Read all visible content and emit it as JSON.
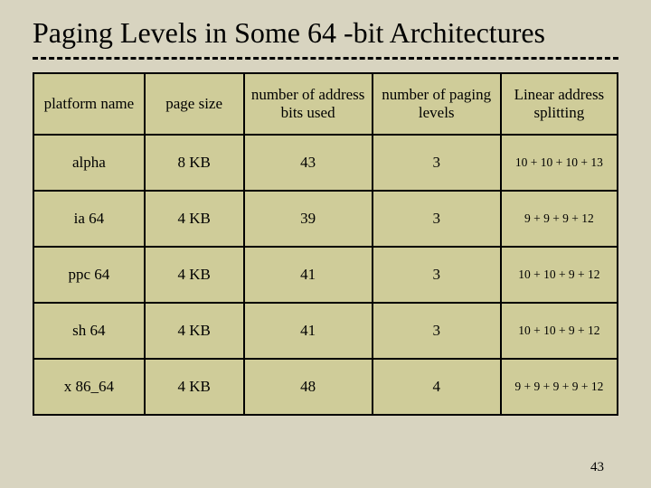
{
  "title": "Paging Levels in Some 64 -bit Architectures",
  "headers": {
    "c1": "platform name",
    "c2": "page size",
    "c3": "number of address bits used",
    "c4": "number of paging levels",
    "c5": "Linear address splitting"
  },
  "rows": [
    {
      "platform": "alpha",
      "page_size": "8 KB",
      "addr_bits": "43",
      "levels": "3",
      "splitting": "10 + 10 + 10 + 13"
    },
    {
      "platform": "ia 64",
      "page_size": "4 KB",
      "addr_bits": "39",
      "levels": "3",
      "splitting": "9 + 9 + 9 + 12"
    },
    {
      "platform": "ppc 64",
      "page_size": "4 KB",
      "addr_bits": "41",
      "levels": "3",
      "splitting": "10 + 10 + 9 + 12"
    },
    {
      "platform": "sh 64",
      "page_size": "4 KB",
      "addr_bits": "41",
      "levels": "3",
      "splitting": "10 + 10 + 9 + 12"
    },
    {
      "platform": "x 86_64",
      "page_size": "4 KB",
      "addr_bits": "48",
      "levels": "4",
      "splitting": "9 + 9 + 9 + 9 + 12"
    }
  ],
  "page_number": "43"
}
